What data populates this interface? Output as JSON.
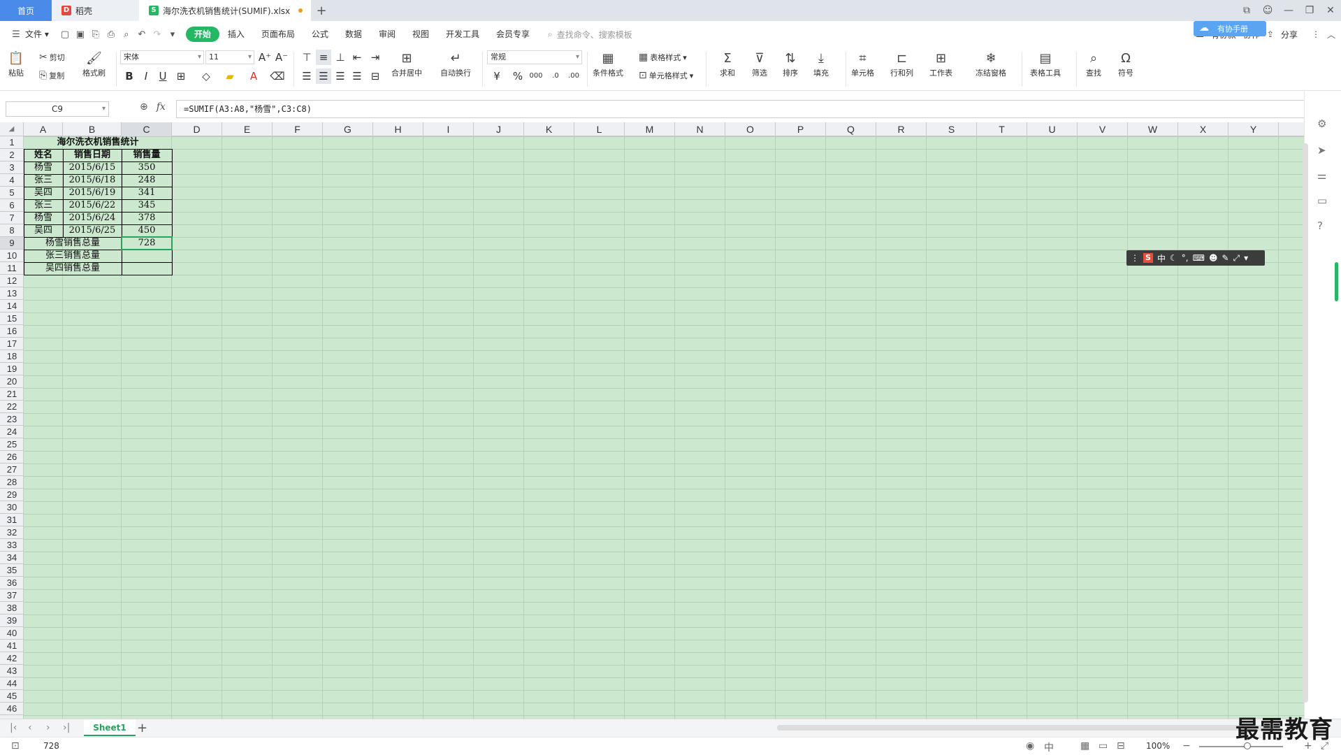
{
  "titlebar": {
    "home_tab": "首页",
    "doc_tab": "稻壳",
    "file_tab": "海尔洗衣机销售统计(SUMIF).xlsx",
    "new_tab": "+"
  },
  "menubar": {
    "file": "文件",
    "tabs": [
      "开始",
      "插入",
      "页面布局",
      "公式",
      "数据",
      "审阅",
      "视图",
      "开发工具",
      "会员专享"
    ],
    "search_placeholder": "查找命令、搜索模板",
    "right": [
      "有协款",
      "协作",
      "分享"
    ],
    "floating": "有协手册"
  },
  "ribbon": {
    "paste": "粘贴",
    "cut": "剪切",
    "copy": "复制",
    "format_painter": "格式刷",
    "font_name": "宋体",
    "font_size": "11",
    "merge": "合并居中",
    "wrap": "自动换行",
    "number_format": "常规",
    "conditional": "条件格式",
    "table_style": "表格样式",
    "cell_style": "单元格样式",
    "sum": "求和",
    "filter": "筛选",
    "sort": "排序",
    "fill": "填充",
    "cell": "单元格",
    "rowcol": "行和列",
    "worksheet": "工作表",
    "freeze": "冻结窗格",
    "table_tools": "表格工具",
    "find": "查找",
    "symbol": "符号"
  },
  "formula_bar": {
    "cell_ref": "C9",
    "fx": "fx",
    "formula": "=SUMIF(A3:A8,\"杨雪\",C3:C8)"
  },
  "columns": [
    "A",
    "B",
    "C",
    "D",
    "E",
    "F",
    "G",
    "H",
    "I",
    "J",
    "K",
    "L",
    "M",
    "N",
    "O",
    "P",
    "Q",
    "R",
    "S",
    "T",
    "U",
    "V",
    "W",
    "X",
    "Y"
  ],
  "rows": [
    "1",
    "2",
    "3",
    "4",
    "5",
    "6",
    "7",
    "8",
    "9",
    "10",
    "11",
    "12",
    "13",
    "14",
    "15",
    "16",
    "17",
    "18",
    "19",
    "20",
    "21",
    "22",
    "23",
    "24",
    "25",
    "26",
    "27",
    "28",
    "29",
    "30",
    "31",
    "32",
    "33",
    "34",
    "35",
    "36",
    "37",
    "38",
    "39",
    "40",
    "41",
    "42",
    "43",
    "44",
    "45",
    "46"
  ],
  "table": {
    "title": "海尔洗衣机销售统计",
    "headers": [
      "姓名",
      "销售日期",
      "销售量"
    ],
    "rows": [
      [
        "杨雪",
        "2015/6/15",
        "350"
      ],
      [
        "张三",
        "2015/6/18",
        "248"
      ],
      [
        "吴四",
        "2015/6/19",
        "341"
      ],
      [
        "张三",
        "2015/6/22",
        "345"
      ],
      [
        "杨雪",
        "2015/6/24",
        "378"
      ],
      [
        "吴四",
        "2015/6/25",
        "450"
      ]
    ],
    "totals": [
      [
        "杨雪销售总量",
        "728"
      ],
      [
        "张三销售总量",
        ""
      ],
      [
        "吴四销售总量",
        ""
      ]
    ]
  },
  "sheet_tab": "Sheet1",
  "status": {
    "value": "728",
    "zoom": "100%"
  },
  "watermark": "最需教育",
  "colors": {
    "accent": "#25b864",
    "sheet_bg": "#cce8cf",
    "home_tab": "#4a8be9"
  }
}
